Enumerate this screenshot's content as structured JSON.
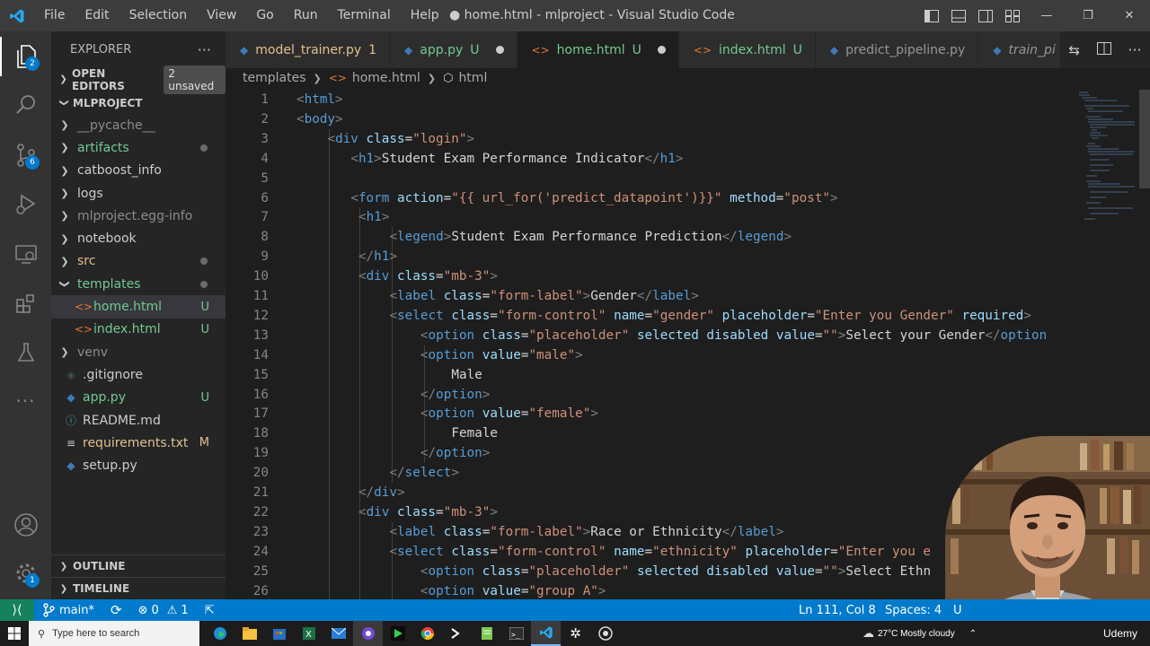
{
  "titlebar": {
    "menu": [
      "File",
      "Edit",
      "Selection",
      "View",
      "Go",
      "Run",
      "Terminal",
      "Help"
    ],
    "title": "● home.html - mlproject - Visual Studio Code"
  },
  "activity": {
    "explorer_badge": "2",
    "scm_badge": "6",
    "settings_badge": "1"
  },
  "sidebar": {
    "title": "EXPLORER",
    "more": "···",
    "open_editors": "OPEN EDITORS",
    "unsaved": "2 unsaved",
    "project": "MLPROJECT",
    "outline": "OUTLINE",
    "timeline": "TIMELINE",
    "tree": [
      {
        "label": "__pycache__",
        "type": "folder",
        "state": "dim"
      },
      {
        "label": "artifacts",
        "type": "folder",
        "state": "green",
        "dot": true
      },
      {
        "label": "catboost_info",
        "type": "folder",
        "state": "normal"
      },
      {
        "label": "logs",
        "type": "folder",
        "state": "normal"
      },
      {
        "label": "mlproject.egg-info",
        "type": "folder",
        "state": "dim"
      },
      {
        "label": "notebook",
        "type": "folder",
        "state": "normal"
      },
      {
        "label": "src",
        "type": "folder",
        "state": "yellow",
        "dot": true
      },
      {
        "label": "templates",
        "type": "folder-open",
        "state": "green",
        "dot": true
      },
      {
        "label": "home.html",
        "type": "html",
        "state": "green",
        "mark": "U",
        "selected": true
      },
      {
        "label": "index.html",
        "type": "html",
        "state": "green",
        "mark": "U"
      },
      {
        "label": "venv",
        "type": "folder",
        "state": "dim"
      },
      {
        "label": ".gitignore",
        "type": "git",
        "state": "normal"
      },
      {
        "label": "app.py",
        "type": "python",
        "state": "green",
        "mark": "U"
      },
      {
        "label": "README.md",
        "type": "info",
        "state": "normal"
      },
      {
        "label": "requirements.txt",
        "type": "text",
        "state": "yellow",
        "mark": "M"
      },
      {
        "label": "setup.py",
        "type": "python",
        "state": "normal"
      }
    ]
  },
  "tabs": [
    {
      "label": "model_trainer.py",
      "mark": "1",
      "icon": "python-icon",
      "color": "#e2c08d"
    },
    {
      "label": "app.py",
      "mark": "U",
      "icon": "python-icon",
      "color": "#73c991",
      "dot": true
    },
    {
      "label": "home.html",
      "mark": "U",
      "icon": "html-icon",
      "color": "#73c991",
      "dot": true,
      "active": true
    },
    {
      "label": "index.html",
      "mark": "U",
      "icon": "html-icon",
      "color": "#73c991"
    },
    {
      "label": "predict_pipeline.py",
      "mark": "",
      "icon": "python-icon",
      "color": "#969696"
    },
    {
      "label": "train_pi",
      "mark": "",
      "icon": "python-icon",
      "color": "#969696",
      "italic": true
    }
  ],
  "breadcrumb": {
    "folder": "templates",
    "file": "home.html",
    "symbol": "html"
  },
  "code_lines": [
    {
      "n": "1",
      "indent": 0,
      "parts": [
        [
          "br",
          "<"
        ],
        [
          "tag",
          "html"
        ],
        [
          "br",
          ">"
        ]
      ]
    },
    {
      "n": "2",
      "indent": 0,
      "parts": [
        [
          "br",
          "<"
        ],
        [
          "tag",
          "body"
        ],
        [
          "br",
          ">"
        ]
      ]
    },
    {
      "n": "3",
      "indent": 4,
      "parts": [
        [
          "br",
          "<"
        ],
        [
          "tag",
          "div "
        ],
        [
          "attr",
          "class"
        ],
        [
          "txt",
          "="
        ],
        [
          "str",
          "\"login\""
        ],
        [
          "br",
          ">"
        ]
      ]
    },
    {
      "n": "4",
      "indent": 7,
      "parts": [
        [
          "br",
          "<"
        ],
        [
          "tag",
          "h1"
        ],
        [
          "br",
          ">"
        ],
        [
          "txt",
          "Student Exam Performance Indicator"
        ],
        [
          "br",
          "</"
        ],
        [
          "tag",
          "h1"
        ],
        [
          "br",
          ">"
        ]
      ]
    },
    {
      "n": "5",
      "indent": 0,
      "parts": []
    },
    {
      "n": "6",
      "indent": 7,
      "parts": [
        [
          "br",
          "<"
        ],
        [
          "tag",
          "form "
        ],
        [
          "attr",
          "action"
        ],
        [
          "txt",
          "="
        ],
        [
          "str",
          "\"{{ url_for('predict_datapoint')}}\""
        ],
        [
          "txt",
          " "
        ],
        [
          "attr",
          "method"
        ],
        [
          "txt",
          "="
        ],
        [
          "str",
          "\"post\""
        ],
        [
          "br",
          ">"
        ]
      ]
    },
    {
      "n": "7",
      "indent": 8,
      "parts": [
        [
          "br",
          "<"
        ],
        [
          "tag",
          "h1"
        ],
        [
          "br",
          ">"
        ]
      ]
    },
    {
      "n": "8",
      "indent": 12,
      "parts": [
        [
          "br",
          "<"
        ],
        [
          "tag",
          "legend"
        ],
        [
          "br",
          ">"
        ],
        [
          "txt",
          "Student Exam Performance Prediction"
        ],
        [
          "br",
          "</"
        ],
        [
          "tag",
          "legend"
        ],
        [
          "br",
          ">"
        ]
      ]
    },
    {
      "n": "9",
      "indent": 8,
      "parts": [
        [
          "br",
          "</"
        ],
        [
          "tag",
          "h1"
        ],
        [
          "br",
          ">"
        ]
      ]
    },
    {
      "n": "10",
      "indent": 8,
      "parts": [
        [
          "br",
          "<"
        ],
        [
          "tag",
          "div "
        ],
        [
          "attr",
          "class"
        ],
        [
          "txt",
          "="
        ],
        [
          "str",
          "\"mb-3\""
        ],
        [
          "br",
          ">"
        ]
      ]
    },
    {
      "n": "11",
      "indent": 12,
      "parts": [
        [
          "br",
          "<"
        ],
        [
          "tag",
          "label "
        ],
        [
          "attr",
          "class"
        ],
        [
          "txt",
          "="
        ],
        [
          "str",
          "\"form-label\""
        ],
        [
          "br",
          ">"
        ],
        [
          "txt",
          "Gender"
        ],
        [
          "br",
          "</"
        ],
        [
          "tag",
          "label"
        ],
        [
          "br",
          ">"
        ]
      ]
    },
    {
      "n": "12",
      "indent": 12,
      "parts": [
        [
          "br",
          "<"
        ],
        [
          "tag",
          "select "
        ],
        [
          "attr",
          "class"
        ],
        [
          "txt",
          "="
        ],
        [
          "str",
          "\"form-control\""
        ],
        [
          "txt",
          " "
        ],
        [
          "attr",
          "name"
        ],
        [
          "txt",
          "="
        ],
        [
          "str",
          "\"gender\""
        ],
        [
          "txt",
          " "
        ],
        [
          "attr",
          "placeholder"
        ],
        [
          "txt",
          "="
        ],
        [
          "str",
          "\"Enter you Gender\""
        ],
        [
          "txt",
          " "
        ],
        [
          "attr",
          "required"
        ],
        [
          "br",
          ">"
        ]
      ]
    },
    {
      "n": "13",
      "indent": 16,
      "parts": [
        [
          "br",
          "<"
        ],
        [
          "tag",
          "option "
        ],
        [
          "attr",
          "class"
        ],
        [
          "txt",
          "="
        ],
        [
          "str",
          "\"placeholder\""
        ],
        [
          "txt",
          " "
        ],
        [
          "attr",
          "selected disabled value"
        ],
        [
          "txt",
          "="
        ],
        [
          "str",
          "\"\""
        ],
        [
          "br",
          ">"
        ],
        [
          "txt",
          "Select your Gender"
        ],
        [
          "br",
          "</"
        ],
        [
          "tag",
          "option"
        ]
      ]
    },
    {
      "n": "14",
      "indent": 16,
      "parts": [
        [
          "br",
          "<"
        ],
        [
          "tag",
          "option "
        ],
        [
          "attr",
          "value"
        ],
        [
          "txt",
          "="
        ],
        [
          "str",
          "\"male\""
        ],
        [
          "br",
          ">"
        ]
      ]
    },
    {
      "n": "15",
      "indent": 20,
      "parts": [
        [
          "txt",
          "Male"
        ]
      ]
    },
    {
      "n": "16",
      "indent": 16,
      "parts": [
        [
          "br",
          "</"
        ],
        [
          "tag",
          "option"
        ],
        [
          "br",
          ">"
        ]
      ]
    },
    {
      "n": "17",
      "indent": 16,
      "parts": [
        [
          "br",
          "<"
        ],
        [
          "tag",
          "option "
        ],
        [
          "attr",
          "value"
        ],
        [
          "txt",
          "="
        ],
        [
          "str",
          "\"female\""
        ],
        [
          "br",
          ">"
        ]
      ]
    },
    {
      "n": "18",
      "indent": 20,
      "parts": [
        [
          "txt",
          "Female"
        ]
      ]
    },
    {
      "n": "19",
      "indent": 16,
      "parts": [
        [
          "br",
          "</"
        ],
        [
          "tag",
          "option"
        ],
        [
          "br",
          ">"
        ]
      ]
    },
    {
      "n": "20",
      "indent": 12,
      "parts": [
        [
          "br",
          "</"
        ],
        [
          "tag",
          "select"
        ],
        [
          "br",
          ">"
        ]
      ]
    },
    {
      "n": "21",
      "indent": 8,
      "parts": [
        [
          "br",
          "</"
        ],
        [
          "tag",
          "div"
        ],
        [
          "br",
          ">"
        ]
      ]
    },
    {
      "n": "22",
      "indent": 8,
      "parts": [
        [
          "br",
          "<"
        ],
        [
          "tag",
          "div "
        ],
        [
          "attr",
          "class"
        ],
        [
          "txt",
          "="
        ],
        [
          "str",
          "\"mb-3\""
        ],
        [
          "br",
          ">"
        ]
      ]
    },
    {
      "n": "23",
      "indent": 12,
      "parts": [
        [
          "br",
          "<"
        ],
        [
          "tag",
          "label "
        ],
        [
          "attr",
          "class"
        ],
        [
          "txt",
          "="
        ],
        [
          "str",
          "\"form-label\""
        ],
        [
          "br",
          ">"
        ],
        [
          "txt",
          "Race or Ethnicity"
        ],
        [
          "br",
          "</"
        ],
        [
          "tag",
          "label"
        ],
        [
          "br",
          ">"
        ]
      ]
    },
    {
      "n": "24",
      "indent": 12,
      "parts": [
        [
          "br",
          "<"
        ],
        [
          "tag",
          "select "
        ],
        [
          "attr",
          "class"
        ],
        [
          "txt",
          "="
        ],
        [
          "str",
          "\"form-control\""
        ],
        [
          "txt",
          " "
        ],
        [
          "attr",
          "name"
        ],
        [
          "txt",
          "="
        ],
        [
          "str",
          "\"ethnicity\""
        ],
        [
          "txt",
          " "
        ],
        [
          "attr",
          "placeholder"
        ],
        [
          "txt",
          "="
        ],
        [
          "str",
          "\"Enter you e"
        ]
      ]
    },
    {
      "n": "25",
      "indent": 16,
      "parts": [
        [
          "br",
          "<"
        ],
        [
          "tag",
          "option "
        ],
        [
          "attr",
          "class"
        ],
        [
          "txt",
          "="
        ],
        [
          "str",
          "\"placeholder\""
        ],
        [
          "txt",
          " "
        ],
        [
          "attr",
          "selected disabled value"
        ],
        [
          "txt",
          "="
        ],
        [
          "str",
          "\"\""
        ],
        [
          "br",
          ">"
        ],
        [
          "txt",
          "Select Ethn"
        ]
      ]
    },
    {
      "n": "26",
      "indent": 16,
      "parts": [
        [
          "br",
          "<"
        ],
        [
          "tag",
          "option "
        ],
        [
          "attr",
          "value"
        ],
        [
          "txt",
          "="
        ],
        [
          "str",
          "\"group A\""
        ],
        [
          "br",
          ">"
        ]
      ]
    }
  ],
  "statusbar": {
    "branch": "main*",
    "errors": "0",
    "warnings": "1",
    "position": "Ln 111, Col 8",
    "spaces": "Spaces: 4",
    "encoding": "U"
  },
  "taskbar": {
    "search_placeholder": "Type here to search",
    "weather": "27°C  Mostly cloudy",
    "watermark": "Udemy"
  }
}
